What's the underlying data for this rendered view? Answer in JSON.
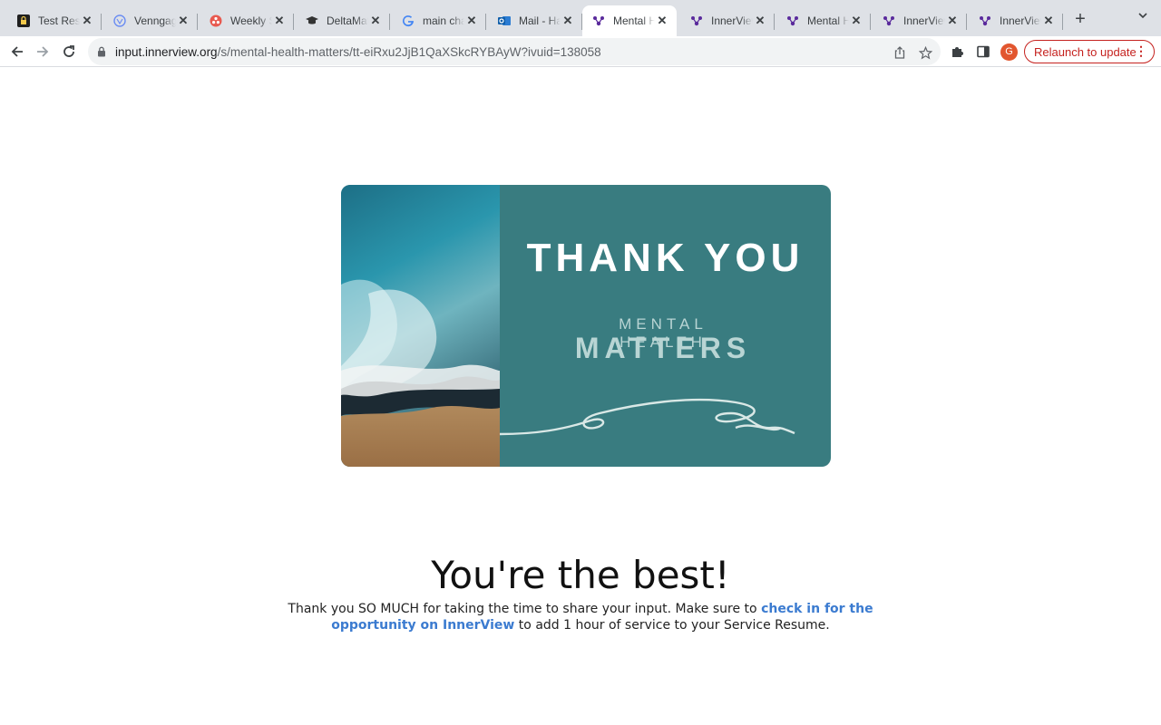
{
  "browser": {
    "tabs": [
      {
        "title": "Test Resu",
        "icon": "lock-badge-icon"
      },
      {
        "title": "Venngage",
        "icon": "venngage-icon"
      },
      {
        "title": "Weekly S",
        "icon": "asana-icon"
      },
      {
        "title": "DeltaMat",
        "icon": "graduation-cap-icon"
      },
      {
        "title": "main cha",
        "icon": "google-icon"
      },
      {
        "title": "Mail - Ha",
        "icon": "outlook-icon"
      },
      {
        "title": "Mental H",
        "icon": "innerview-icon",
        "active": true
      },
      {
        "title": "InnerView",
        "icon": "innerview-icon"
      },
      {
        "title": "Mental H",
        "icon": "innerview-icon"
      },
      {
        "title": "InnerView",
        "icon": "innerview-icon"
      },
      {
        "title": "InnerView",
        "icon": "innerview-icon"
      }
    ],
    "url_host": "input.innerview.org",
    "url_path": "/s/mental-health-matters/tt-eiRxu2JjB1QaXSkcRYBAyW?ivuid=138058",
    "avatar_letter": "G",
    "relaunch_label": "Relaunch to update"
  },
  "banner": {
    "thank_you": "THANK YOU",
    "mental_health": "MENTAL HEALTH",
    "matters": "MATTERS"
  },
  "page": {
    "headline": "You're the best!",
    "body_before": "Thank you SO MUCH for taking the time to share your input. Make sure to ",
    "body_link": "check in for the opportunity on InnerView",
    "body_after": " to add 1 hour of service to your Service Resume."
  },
  "colors": {
    "banner_teal": "#397c80",
    "link_blue": "#3b7bd0",
    "relaunch_red": "#c5221f"
  }
}
